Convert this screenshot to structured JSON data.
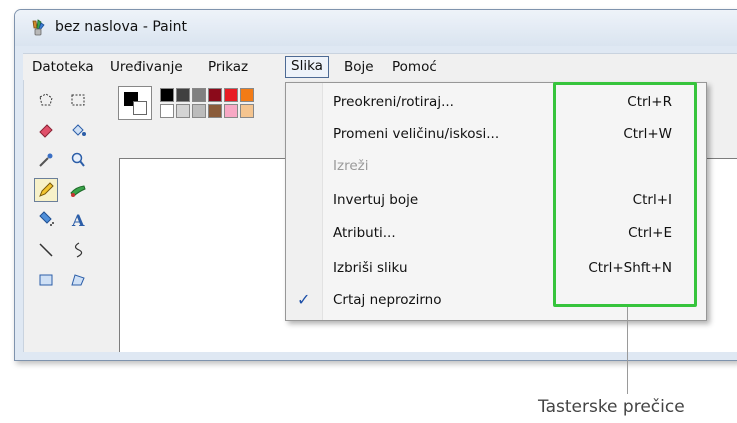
{
  "window": {
    "title": "bez naslova - Paint"
  },
  "menubar": {
    "items": [
      {
        "label": "Datoteka"
      },
      {
        "label": "Uređivanje"
      },
      {
        "label": "Prikaz"
      },
      {
        "label": "Slika"
      },
      {
        "label": "Boje"
      },
      {
        "label": "Pomoć"
      }
    ]
  },
  "dropdown": {
    "items": [
      {
        "label": "Preokreni/rotiraj...",
        "shortcut": "Ctrl+R"
      },
      {
        "label": "Promeni veličinu/iskosi...",
        "shortcut": "Ctrl+W"
      },
      {
        "label": "Izreži",
        "shortcut": "",
        "disabled": true
      },
      {
        "label": "Invertuj boje",
        "shortcut": "Ctrl+I"
      },
      {
        "label": "Atributi...",
        "shortcut": "Ctrl+E"
      },
      {
        "label": "Izbriši sliku",
        "shortcut": "Ctrl+Shft+N"
      },
      {
        "label": "Crtaj neprozirno",
        "shortcut": "",
        "checked": true,
        "check_glyph": "✓"
      }
    ]
  },
  "callout": {
    "text": "Tasterske prečice"
  },
  "colors": {
    "highlight": "#36c43c",
    "palette_row1": [
      "#000000",
      "#404040",
      "#808080",
      "#8b0a1a",
      "#e81b23",
      "#f27b16"
    ],
    "palette_row2": [
      "#ffffff",
      "#d4d4d4",
      "#bcbcbc",
      "#8a5b3a",
      "#f7a8c4",
      "#f4c48f"
    ]
  },
  "tools": [
    "free-select-icon",
    "rect-select-icon",
    "eraser-icon",
    "fill-icon",
    "eyedropper-icon",
    "magnifier-icon",
    "pencil-icon",
    "brush-icon",
    "airbrush-icon",
    "text-icon",
    "line-icon",
    "curve-icon",
    "rectangle-icon",
    "polygon-icon"
  ]
}
